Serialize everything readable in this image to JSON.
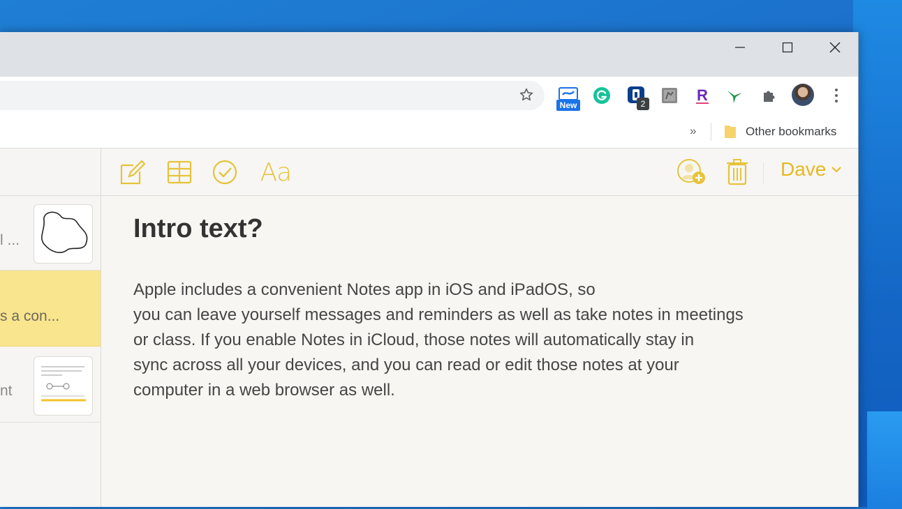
{
  "browser": {
    "window_controls": {
      "minimize": "minimize",
      "maximize": "maximize",
      "close": "close"
    },
    "toolbar": {
      "bookmark_star_icon": "star-outline-icon",
      "extensions": [
        {
          "name": "news-extension",
          "icon": "newspaper-icon",
          "badge": "New"
        },
        {
          "name": "grammarly-extension",
          "icon": "grammarly-g-icon"
        },
        {
          "name": "password-manager-extension",
          "icon": "shield-keyhole-icon",
          "badge": "2"
        },
        {
          "name": "notebook-extension",
          "icon": "notebook-icon"
        },
        {
          "name": "r-extension",
          "icon": "letter-r-icon"
        },
        {
          "name": "hummingbird-extension",
          "icon": "hummingbird-icon"
        },
        {
          "name": "extensions-menu",
          "icon": "puzzle-piece-icon"
        }
      ],
      "profile_avatar": "avatar",
      "more_menu_icon": "vertical-dots-icon"
    },
    "bookmarks_bar": {
      "overflow_icon": "»",
      "other_bookmarks_label": "Other bookmarks"
    }
  },
  "notes_app": {
    "accent_color": "#e6b822",
    "selected_row_color": "#f8e58e",
    "toolbar": {
      "compose_icon": "compose-icon",
      "table_icon": "table-icon",
      "checklist_icon": "checklist-icon",
      "format_label": "Aa",
      "collaborate_icon": "add-person-icon",
      "trash_icon": "trash-icon",
      "user_name": "Dave"
    },
    "list": [
      {
        "snippet": "l ...",
        "has_thumbnail": true
      },
      {
        "snippet": "s a con...",
        "selected": true
      },
      {
        "snippet": "nt",
        "has_thumbnail": true
      }
    ],
    "note": {
      "title": "Intro text?",
      "body_lines": [
        "Apple includes a convenient Notes app in iOS and iPadOS, so",
        "you can leave yourself messages and reminders as well as take notes in meetings",
        "or class. If you enable Notes in iCloud, those notes will automatically stay in",
        "sync across all your devices, and you can read or edit those notes at your",
        "computer in a web browser as well."
      ]
    }
  }
}
